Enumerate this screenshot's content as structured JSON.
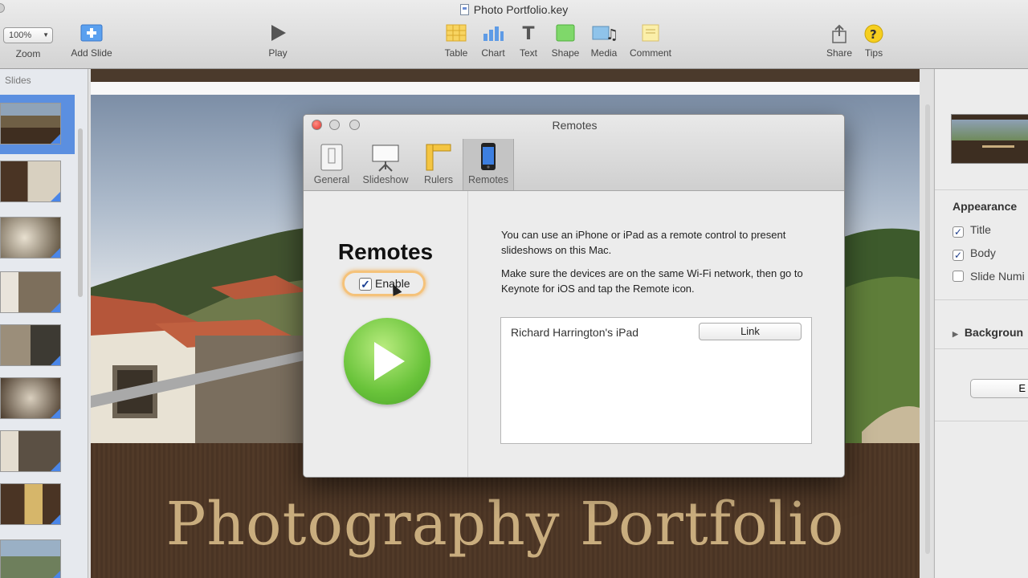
{
  "window": {
    "title": "Photo Portfolio.key"
  },
  "toolbar": {
    "zoom": {
      "value": "100%",
      "label": "Zoom"
    },
    "add_slide": "Add Slide",
    "play": "Play",
    "table": "Table",
    "chart": "Chart",
    "text": "Text",
    "shape": "Shape",
    "media": "Media",
    "comment": "Comment",
    "share": "Share",
    "tips": "Tips"
  },
  "sidebar": {
    "heading": "Slides",
    "slide_count_visible": 10
  },
  "slide": {
    "title": "Photography Portfolio"
  },
  "dialog": {
    "title": "Remotes",
    "tabs": [
      "General",
      "Slideshow",
      "Rulers",
      "Remotes"
    ],
    "selected_tab": "Remotes",
    "heading": "Remotes",
    "enable_label": "Enable",
    "enable_checked": true,
    "desc1": "You can use an iPhone or iPad as a remote control to present slideshows on this Mac.",
    "desc2": "Make sure the devices are on the same Wi-Fi network, then go to Keynote for iOS and tap the Remote icon.",
    "device_name": "Richard Harrington's iPad",
    "link_button": "Link"
  },
  "inspector": {
    "appearance": "Appearance",
    "title_check": "Title",
    "body_check": "Body",
    "slide_number_check": "Slide Numi",
    "background": "Backgroun",
    "button_fragment": "E"
  },
  "colors": {
    "accent_blue": "#4a86e8",
    "slide_brown": "#4b3a2c",
    "title_gold": "#c9ad7e",
    "play_green": "#69c33a",
    "enable_highlight": "#f5c27a"
  }
}
